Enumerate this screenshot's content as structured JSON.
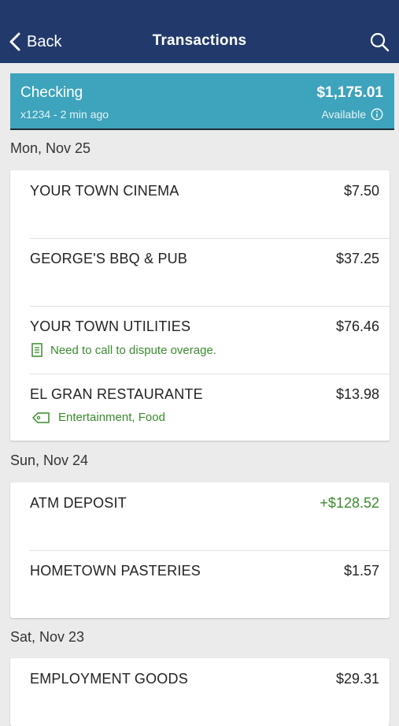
{
  "nav": {
    "back_label": "Back",
    "title": "Transactions"
  },
  "account": {
    "name": "Checking",
    "subtitle": "x1234 - 2 min ago",
    "balance": "$1,175.01",
    "balance_label": "Available"
  },
  "groups": [
    {
      "date": "Mon, Nov 25",
      "transactions": [
        {
          "merchant": "YOUR TOWN CINEMA",
          "amount": "$7.50"
        },
        {
          "merchant": "GEORGE'S BBQ & PUB",
          "amount": "$37.25"
        },
        {
          "merchant": "YOUR TOWN UTILITIES",
          "amount": "$76.46",
          "note": "Need to call to dispute overage."
        },
        {
          "merchant": "EL GRAN RESTAURANTE",
          "amount": "$13.98",
          "tags": "Entertainment, Food"
        }
      ]
    },
    {
      "date": "Sun, Nov 24",
      "transactions": [
        {
          "merchant": "ATM DEPOSIT",
          "amount": "+$128.52"
        },
        {
          "merchant": "HOMETOWN PASTERIES",
          "amount": "$1.57"
        }
      ]
    },
    {
      "date": "Sat, Nov 23",
      "transactions": [
        {
          "merchant": "EMPLOYMENT GOODS",
          "amount": "$29.31"
        }
      ]
    }
  ],
  "colors": {
    "navbar": "#213a6b",
    "account_banner": "#3ea3bc",
    "credit_green": "#3a8a2c"
  },
  "icons": [
    "chevron-left-icon",
    "search-icon",
    "info-icon",
    "note-icon",
    "tag-icon"
  ]
}
